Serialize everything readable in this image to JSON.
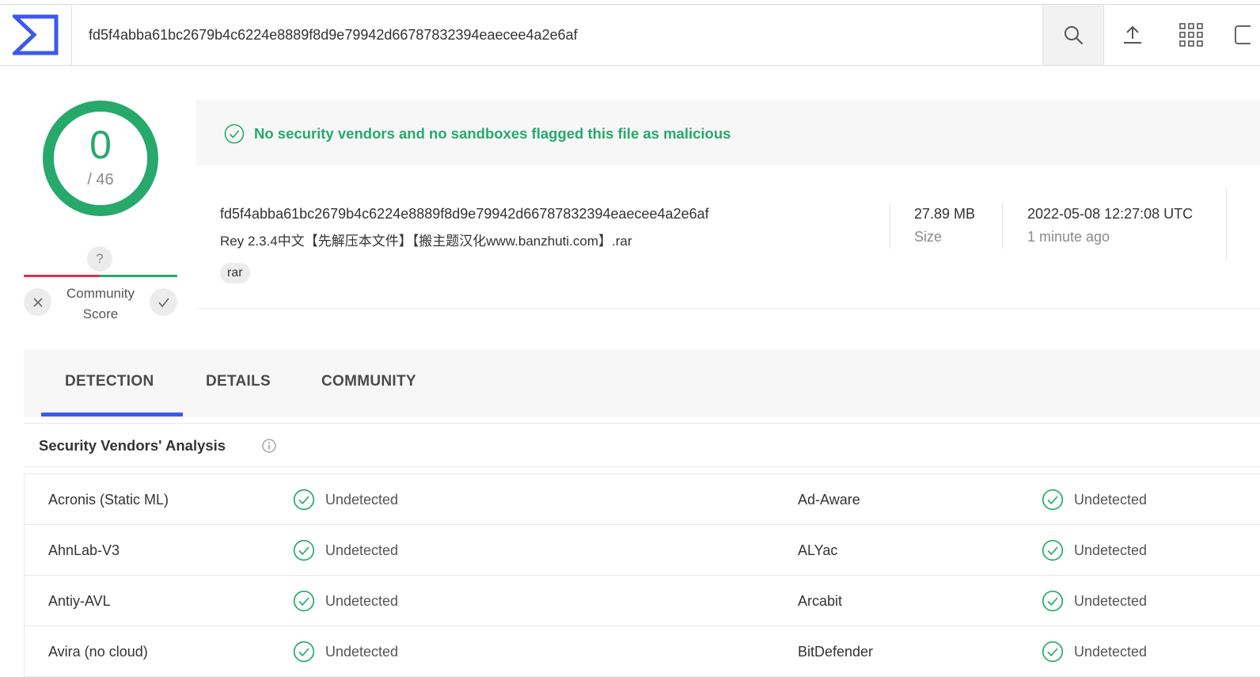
{
  "header": {
    "search_value": "fd5f4abba61bc2679b4c6224e8889f8d9e79942d66787832394eaecee4a2e6af",
    "icons": [
      "virustotal-logo-icon",
      "search-icon",
      "upload-icon",
      "apps-grid-icon"
    ]
  },
  "score": {
    "detections": "0",
    "total": "/ 46",
    "community_question": "?",
    "community_label_line1": "Community",
    "community_label_line2": "Score"
  },
  "banner": {
    "message": "No security vendors and no sandboxes flagged this file as malicious"
  },
  "file": {
    "hash": "fd5f4abba61bc2679b4c6224e8889f8d9e79942d66787832394eaecee4a2e6af",
    "name": "Rey 2.3.4中文【先解压本文件】【搬主题汉化www.banzhuti.com】.rar",
    "tag": "rar",
    "size": "27.89 MB",
    "size_label": "Size",
    "date": "2022-05-08 12:27:08 UTC",
    "date_ago": "1 minute ago"
  },
  "tabs": [
    {
      "label": "DETECTION",
      "active": true
    },
    {
      "label": "DETAILS",
      "active": false
    },
    {
      "label": "COMMUNITY",
      "active": false
    }
  ],
  "section": {
    "title": "Security Vendors' Analysis"
  },
  "colors": {
    "accent_green": "#27a96c",
    "accent_blue": "#3b58f0",
    "negative_red": "#e0304e"
  },
  "vendors": [
    {
      "left_name": "Acronis (Static ML)",
      "left_result": "Undetected",
      "right_name": "Ad-Aware",
      "right_result": "Undetected"
    },
    {
      "left_name": "AhnLab-V3",
      "left_result": "Undetected",
      "right_name": "ALYac",
      "right_result": "Undetected"
    },
    {
      "left_name": "Antiy-AVL",
      "left_result": "Undetected",
      "right_name": "Arcabit",
      "right_result": "Undetected"
    },
    {
      "left_name": "Avira (no cloud)",
      "left_result": "Undetected",
      "right_name": "BitDefender",
      "right_result": "Undetected"
    }
  ]
}
